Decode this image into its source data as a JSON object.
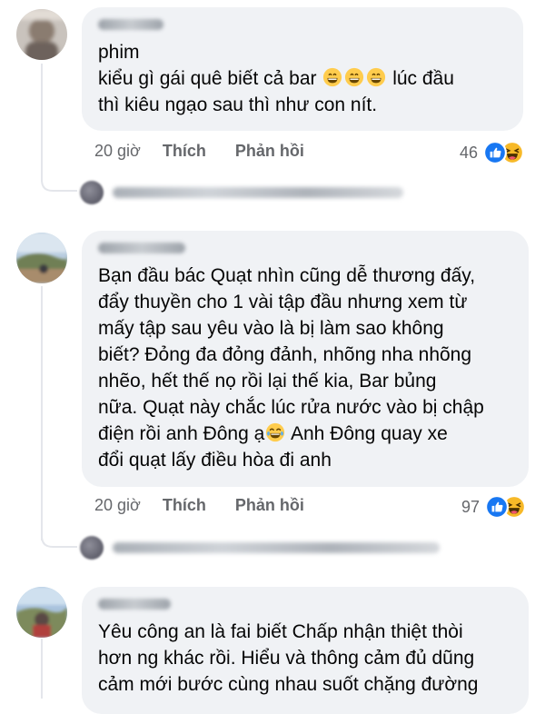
{
  "comments": [
    {
      "text": "phim\n kiểu gì gái quê biết cả bar 😄😄😄 lúc đầu thì kiêu ngạo sau thì như con nít.",
      "line1": "phim",
      "line2_a": " kiểu gì gái quê biết cả bar",
      "line2_b": "lúc đầu",
      "line3": "thì kiêu ngạo sau thì như con nít.",
      "time": "20 giờ",
      "like_label": "Thích",
      "reply_label": "Phản hồi",
      "reaction_count": "46",
      "reactions": [
        "like-icon",
        "haha-icon"
      ]
    },
    {
      "line1": "Bạn đầu bác Quạt nhìn cũng dễ thương đấy,",
      "line2": "đẩy thuyền cho 1 vài tập đầu nhưng xem từ",
      "line3": "mấy tập sau yêu vào là bị làm sao không",
      "line4": "biết? Đỏng đa đỏng đảnh, nhõng nha nhõng",
      "line5": "nhẽo, hết thế nọ rồi lại thế kia, Bar bủng",
      "line6": "nữa. Quạt này chắc lúc rửa nước vào bị chập",
      "line7_a": "điện rồi anh Đông ạ",
      "line7_b": " Anh Đông quay xe",
      "line8": "đổi quạt lấy điều hòa đi anh",
      "time": "20 giờ",
      "like_label": "Thích",
      "reply_label": "Phản hồi",
      "reaction_count": "97",
      "reactions": [
        "like-icon",
        "haha-icon"
      ]
    },
    {
      "line1": "Yêu công an là fai biết Chấp nhận thiệt thòi",
      "line2": "hơn ng khác rồi. Hiểu và thông cảm đủ dũng",
      "line3": "cảm mới bước cùng nhau suốt chặng đường"
    }
  ],
  "colors": {
    "bubble": "#f0f2f5",
    "meta_text": "#65676b",
    "like_blue": "#1877f2",
    "haha_yellow": "#f7b928",
    "thread_line": "#e4e6eb"
  }
}
